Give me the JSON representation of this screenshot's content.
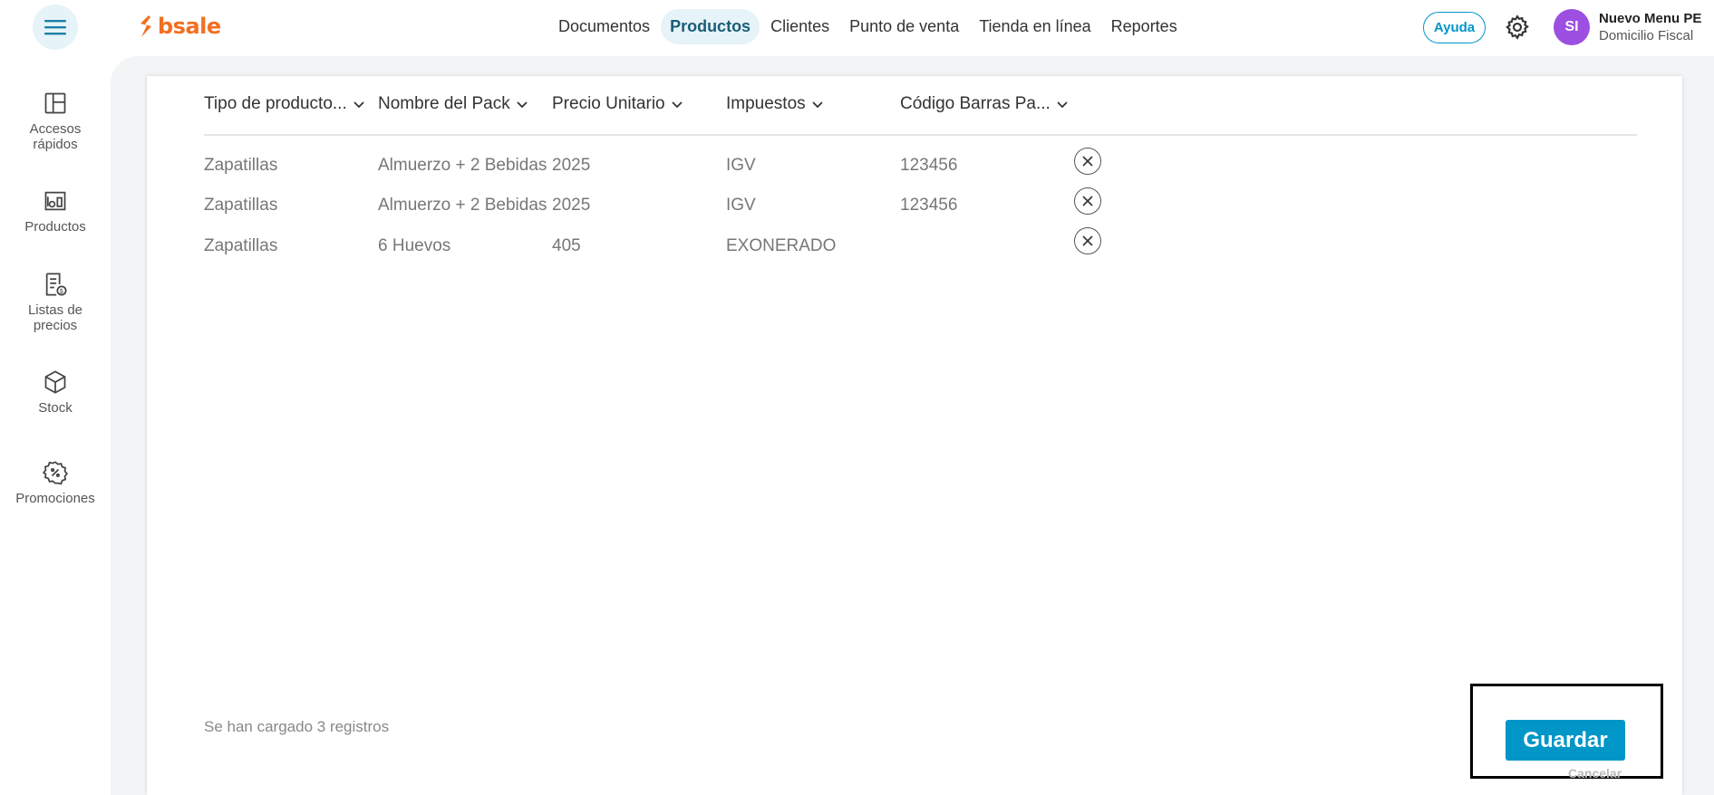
{
  "header": {
    "logo": "bsale",
    "nav": [
      "Documentos",
      "Productos",
      "Clientes",
      "Punto de venta",
      "Tienda en línea",
      "Reportes"
    ],
    "active_nav": "Productos",
    "help": "Ayuda",
    "avatar_initials": "SI",
    "user_name": "Nuevo Menu PE",
    "user_sub": "Domicilio Fiscal"
  },
  "sidebar": {
    "items": [
      {
        "label": "Accesos rápidos",
        "icon": "layout-icon"
      },
      {
        "label": "Productos",
        "icon": "products-icon"
      },
      {
        "label": "Listas de precios",
        "icon": "price-list-icon"
      },
      {
        "label": "Stock",
        "icon": "box-icon"
      },
      {
        "label": "Promociones",
        "icon": "percent-badge-icon"
      }
    ]
  },
  "table": {
    "headers": [
      "Tipo de producto...",
      "Nombre del Pack",
      "Precio Unitario",
      "Impuestos",
      "Código Barras Pa..."
    ],
    "rows": [
      [
        "Zapatillas",
        "Almuerzo + 2 Bebidas",
        "2025",
        "IGV",
        "123456"
      ],
      [
        "Zapatillas",
        "Almuerzo + 2 Bebidas",
        "2025",
        "IGV",
        "123456"
      ],
      [
        "Zapatillas",
        "6 Huevos",
        "405",
        "EXONERADO",
        ""
      ]
    ]
  },
  "footer": {
    "status": "Se han cargado 3 registros",
    "save": "Guardar",
    "cancel": "Cancelar"
  },
  "colors": {
    "accent": "#0096c7",
    "brand": "#f36f21",
    "avatar": "#9c4fe0"
  }
}
